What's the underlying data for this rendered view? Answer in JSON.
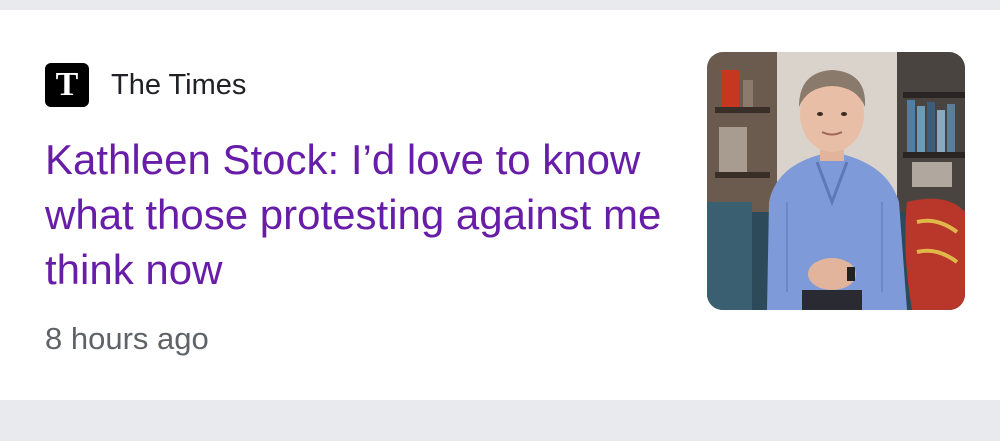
{
  "article": {
    "source": {
      "logo_letter": "T",
      "logo_icon": "the-times-logo-icon",
      "name": "The Times"
    },
    "headline": "Kathleen Stock: I’d love to know what those protesting against me think now",
    "timestamp": "8 hours ago",
    "thumbnail": {
      "icon": "article-photo-thumbnail"
    }
  },
  "colors": {
    "page_background": "#e8eaed",
    "card_background": "#ffffff",
    "headline_visited": "#681da8",
    "source_text": "#202124",
    "timestamp_text": "#5f6368"
  }
}
